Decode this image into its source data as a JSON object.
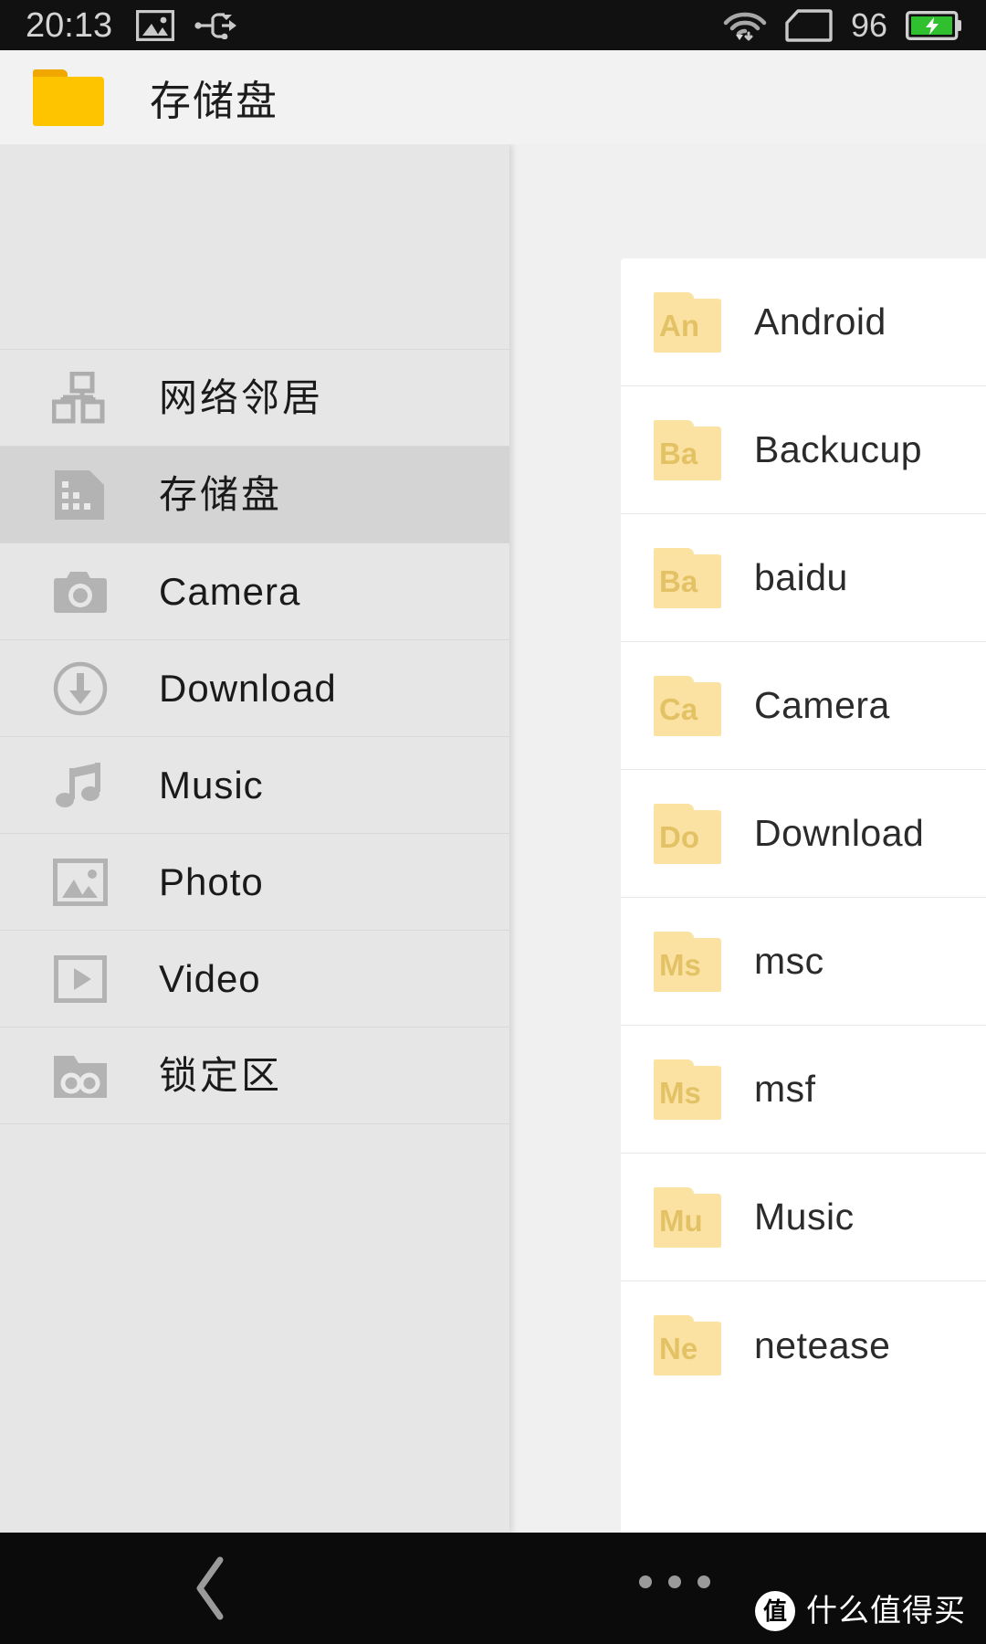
{
  "status_bar": {
    "time": "20:13",
    "battery_percent": "96",
    "icons": [
      "screenshot-image-icon",
      "usb-icon",
      "wifi-icon",
      "sim-card-icon",
      "battery-charging-icon"
    ]
  },
  "title_bar": {
    "icon": "folder-icon",
    "title": "存储盘"
  },
  "sidebar": {
    "items": [
      {
        "label": "网络邻居",
        "icon": "network-nodes-icon",
        "selected": false,
        "cjk": true
      },
      {
        "label": "存储盘",
        "icon": "sd-card-icon",
        "selected": true,
        "cjk": true
      },
      {
        "label": "Camera",
        "icon": "camera-icon",
        "selected": false,
        "cjk": false
      },
      {
        "label": "Download",
        "icon": "download-circle-icon",
        "selected": false,
        "cjk": false
      },
      {
        "label": "Music",
        "icon": "music-note-icon",
        "selected": false,
        "cjk": false
      },
      {
        "label": "Photo",
        "icon": "image-icon",
        "selected": false,
        "cjk": false
      },
      {
        "label": "Video",
        "icon": "video-play-icon",
        "selected": false,
        "cjk": false
      },
      {
        "label": "锁定区",
        "icon": "locked-folder-icon",
        "selected": false,
        "cjk": true
      }
    ]
  },
  "file_list": {
    "items": [
      {
        "name": "Android",
        "abbr": "An"
      },
      {
        "name": "Backucup",
        "abbr": "Ba"
      },
      {
        "name": "baidu",
        "abbr": "Ba"
      },
      {
        "name": "Camera",
        "abbr": "Ca"
      },
      {
        "name": "Download",
        "abbr": "Do"
      },
      {
        "name": "msc",
        "abbr": "Ms"
      },
      {
        "name": "msf",
        "abbr": "Ms"
      },
      {
        "name": "Music",
        "abbr": "Mu"
      },
      {
        "name": "netease",
        "abbr": "Ne"
      }
    ]
  },
  "nav_bar": {
    "back_icon": "back-chevron-icon",
    "menu_icon": "overflow-dots-icon"
  },
  "watermark": {
    "badge": "值",
    "text": "什么值得买"
  },
  "colors": {
    "status_bar_bg": "#111111",
    "title_bar_bg": "#f2f2f2",
    "sidebar_bg": "#e6e6e6",
    "sidebar_selected_bg": "#d4d4d4",
    "panel_bg": "#f0f0f0",
    "card_bg": "#ffffff",
    "folder_yellow": "#ffc400",
    "folder_light_yellow": "#fbe2a2",
    "folder_abbr": "#e3c266",
    "nav_bar_bg": "#0b0b0b",
    "battery_green": "#2fbf2f"
  }
}
